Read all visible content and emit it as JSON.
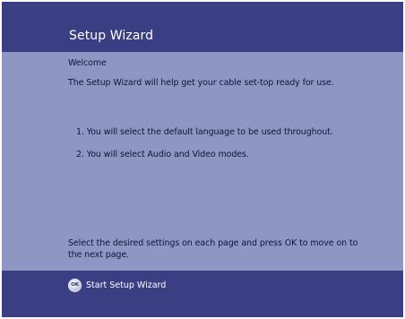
{
  "header": {
    "title": "Setup Wizard"
  },
  "content": {
    "welcome": "Welcome",
    "intro": "The Setup Wizard will help get your cable set-top ready for use.",
    "steps": [
      "1. You will select the default language to be used throughout.",
      "2. You will select Audio and Video modes."
    ],
    "instructions": "Select the desired settings on each page and press OK to move on to the next page."
  },
  "footer": {
    "ok_icon_text": "OK",
    "ok_icon": "ok-button-icon",
    "start_label": "Start Setup Wizard"
  },
  "colors": {
    "band": "#3a3f84",
    "panel": "#8f96c4",
    "text_dark": "#111436",
    "text_light": "#ffffff"
  }
}
